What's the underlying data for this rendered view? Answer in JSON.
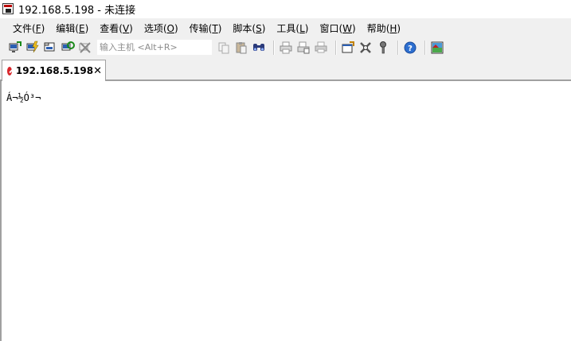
{
  "window": {
    "title": "192.168.5.198 - 未连接"
  },
  "menubar": {
    "items": [
      {
        "label": "文件(",
        "accel": "F",
        "close": ")"
      },
      {
        "label": "编辑(",
        "accel": "E",
        "close": ")"
      },
      {
        "label": "查看(",
        "accel": "V",
        "close": ")"
      },
      {
        "label": "选项(",
        "accel": "O",
        "close": ")"
      },
      {
        "label": "传输(",
        "accel": "T",
        "close": ")"
      },
      {
        "label": "脚本(",
        "accel": "S",
        "close": ")"
      },
      {
        "label": "工具(",
        "accel": "L",
        "close": ")"
      },
      {
        "label": "窗口(",
        "accel": "W",
        "close": ")"
      },
      {
        "label": "帮助(",
        "accel": "H",
        "close": ")"
      }
    ]
  },
  "toolbar": {
    "host_placeholder": "输入主机 <Alt+R>",
    "host_value": "",
    "icons": [
      "connect-icon",
      "quick-connect-icon",
      "connect-in-tab-icon",
      "reconnect-icon",
      "disconnect-icon",
      "copy-icon",
      "paste-icon",
      "find-icon",
      "print-setup-icon",
      "print-selection-icon",
      "print-icon",
      "session-options-icon",
      "global-options-icon",
      "keymap-icon",
      "help-icon",
      "sftp-icon"
    ]
  },
  "tabs": [
    {
      "label": "192.168.5.198",
      "status": "disconnected",
      "close_glyph": "✕"
    }
  ],
  "terminal": {
    "lines": [
      "Á¬½Ó³¬"
    ]
  },
  "colors": {
    "chrome": "#f0f0f0",
    "tab_status_disconnected": "#d8262b",
    "border": "#a0a0a0"
  }
}
